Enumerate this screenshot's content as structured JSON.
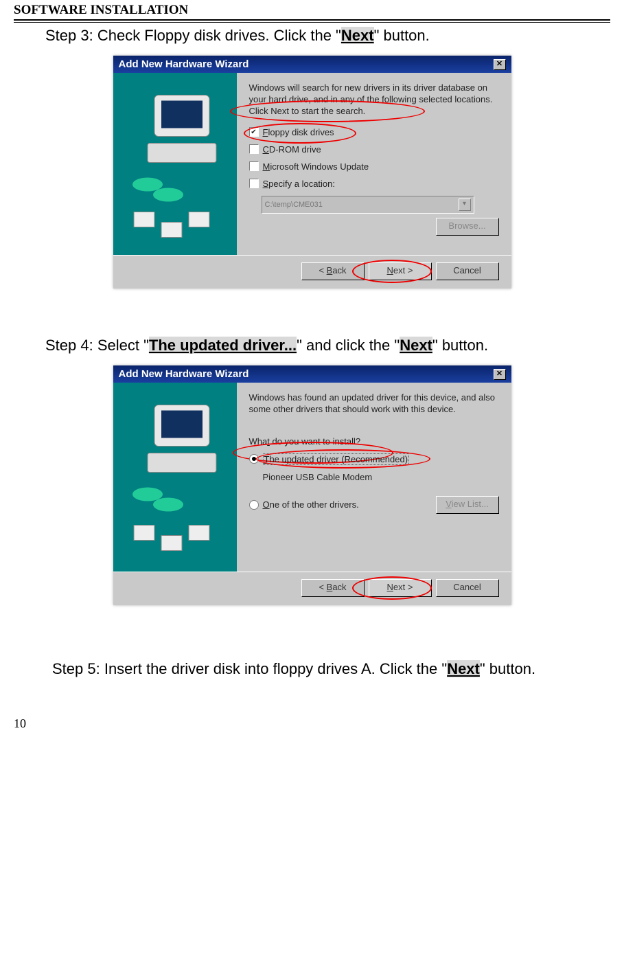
{
  "header": "SOFTWARE INSTALLATION",
  "step3": {
    "prefix": "Step 3: Check Floppy disk drives. Click the \"",
    "hl": "Next",
    "suffix": "\" button."
  },
  "step4": {
    "prefix": "Step 4: Select \"",
    "hl1": "The updated driver...",
    "mid": "\" and click the \"",
    "hl2": "Next",
    "suffix": "\" button."
  },
  "step5": {
    "prefix": "Step 5: Insert the driver disk into floppy drives A. Click the \"",
    "hl": "Next",
    "suffix": "\" button."
  },
  "dialog1": {
    "title": "Add New Hardware Wizard",
    "intro": "Windows will search for new drivers in its driver database on your hard drive, and in any of the following selected locations. Click Next to start the search.",
    "opts": {
      "floppy": "Floppy disk drives",
      "floppy_u": "F",
      "cdrom": "CD-ROM drive",
      "cdrom_u": "C",
      "wu": "Microsoft Windows Update",
      "wu_u": "M",
      "specify": "Specify a location:",
      "specify_u": "S"
    },
    "path": "C:\\temp\\CME031",
    "browse": "Browse...",
    "back": "< Back",
    "next": "Next >",
    "cancel": "Cancel"
  },
  "dialog2": {
    "title": "Add New Hardware Wizard",
    "intro": "Windows has found an updated driver for this device, and also some other drivers that should work with this device.",
    "question": "What do you want to install?",
    "r1": "The updated driver (Recommended)",
    "r1_u": "T",
    "r1_sub": "Pioneer USB Cable Modem",
    "r2": "One of the other drivers.",
    "r2_u": "O",
    "view": "View List...",
    "back": "< Back",
    "next": "Next >",
    "cancel": "Cancel"
  },
  "pageNum": "10"
}
